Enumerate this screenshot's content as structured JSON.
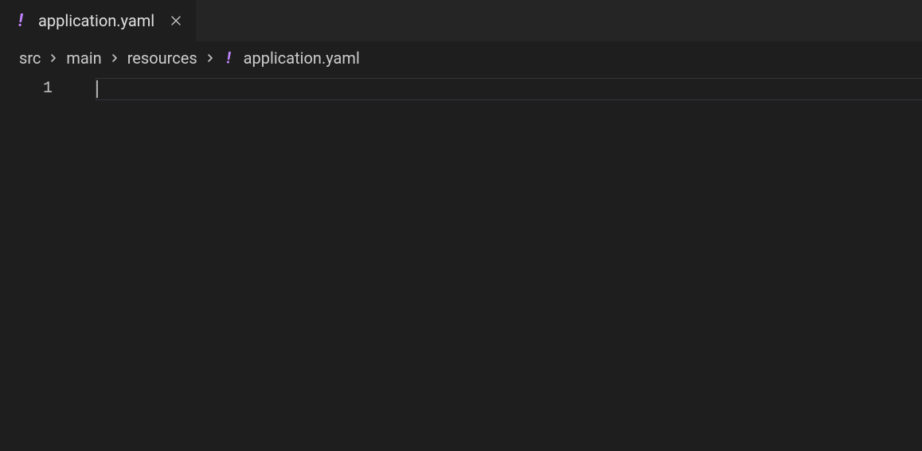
{
  "tab": {
    "filename": "application.yaml",
    "icon": "yaml-file-icon"
  },
  "breadcrumb": {
    "segments": [
      "src",
      "main",
      "resources"
    ],
    "file": {
      "name": "application.yaml",
      "icon": "yaml-file-icon"
    }
  },
  "editor": {
    "lineNumbers": [
      "1"
    ],
    "lines": [
      ""
    ]
  }
}
